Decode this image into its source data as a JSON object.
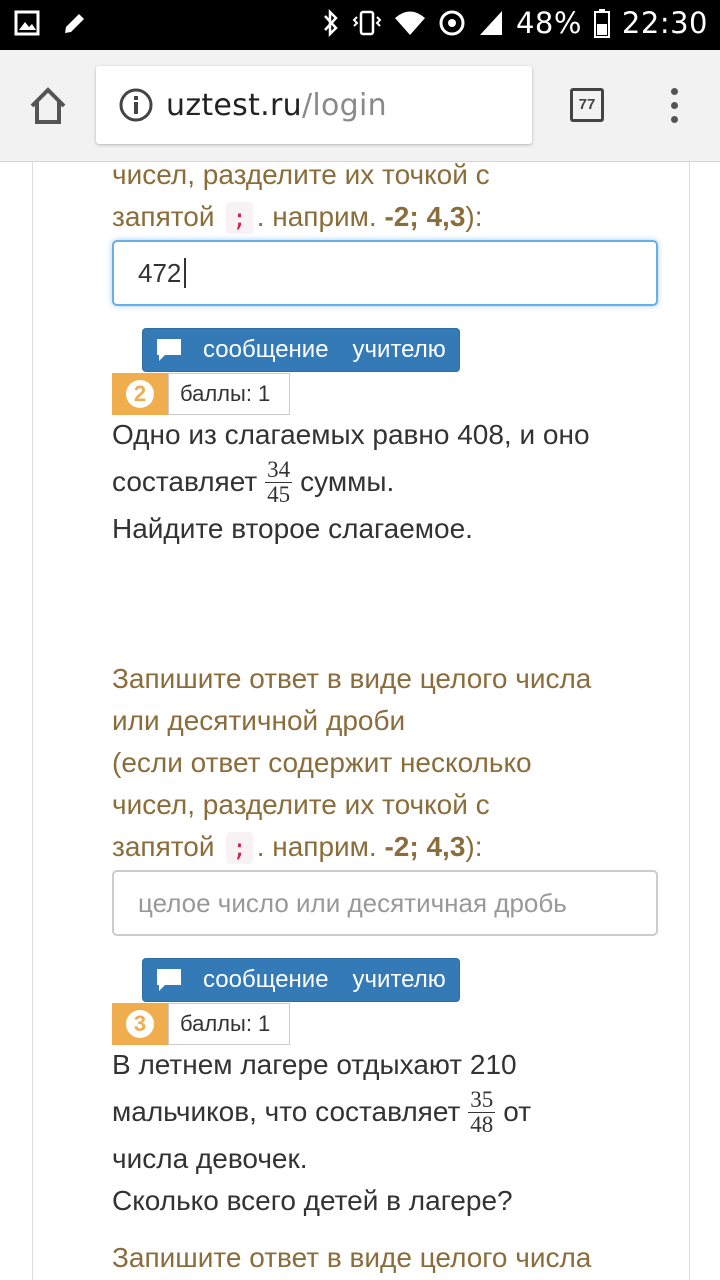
{
  "status_bar": {
    "battery": "48%",
    "time": "22:30",
    "icons": [
      "image-icon",
      "edit-icon",
      "bluetooth-icon",
      "vibrate-icon",
      "wifi-icon",
      "data-sync-icon",
      "signal-icon",
      "battery-icon"
    ]
  },
  "browser": {
    "url_host": "uztest.ru",
    "url_path": "/login",
    "tab_count": "77"
  },
  "task1": {
    "instruction_partial_line1": "чисел, разделите их точкой с",
    "instruction_prefix": "запятой",
    "separator": ";",
    "instruction_example_prefix": ". наприм.",
    "example": "-2; 4,3",
    "instruction_suffix": "):",
    "answer_value": "472"
  },
  "message_button": {
    "label_word1": "сообщение",
    "label_word2": "учителю"
  },
  "task2": {
    "number": "2",
    "points": "баллы: 1",
    "text_line1": "Одно из слагаемых равно 408, и оно",
    "text_line2_before": "составляет",
    "fraction_num": "34",
    "fraction_den": "45",
    "text_line2_after": "суммы.",
    "text_line3": "Найдите второе слагаемое.",
    "instruction_line1": "Запишите ответ в виде целого числа",
    "instruction_line2": "или десятичной дроби",
    "instruction_line3": "(если ответ содержит несколько",
    "instruction_line4": "чисел, разделите их точкой с",
    "instruction_prefix": "запятой",
    "separator": ";",
    "instruction_example_prefix": ". наприм.",
    "example": "-2; 4,3",
    "instruction_suffix": "):",
    "answer_placeholder": "целое число или десятичная дробь"
  },
  "task3": {
    "number": "3",
    "points": "баллы: 1",
    "text_line1": "В летнем лагере отдыхают 210",
    "text_line2_before": "мальчиков, что составляет",
    "fraction_num": "35",
    "fraction_den": "48",
    "text_line2_after": "от",
    "text_line3": "числа девочек.",
    "text_line4": "Сколько всего детей в лагере?",
    "instruction_line1": "Запишите ответ в виде целого числа"
  }
}
